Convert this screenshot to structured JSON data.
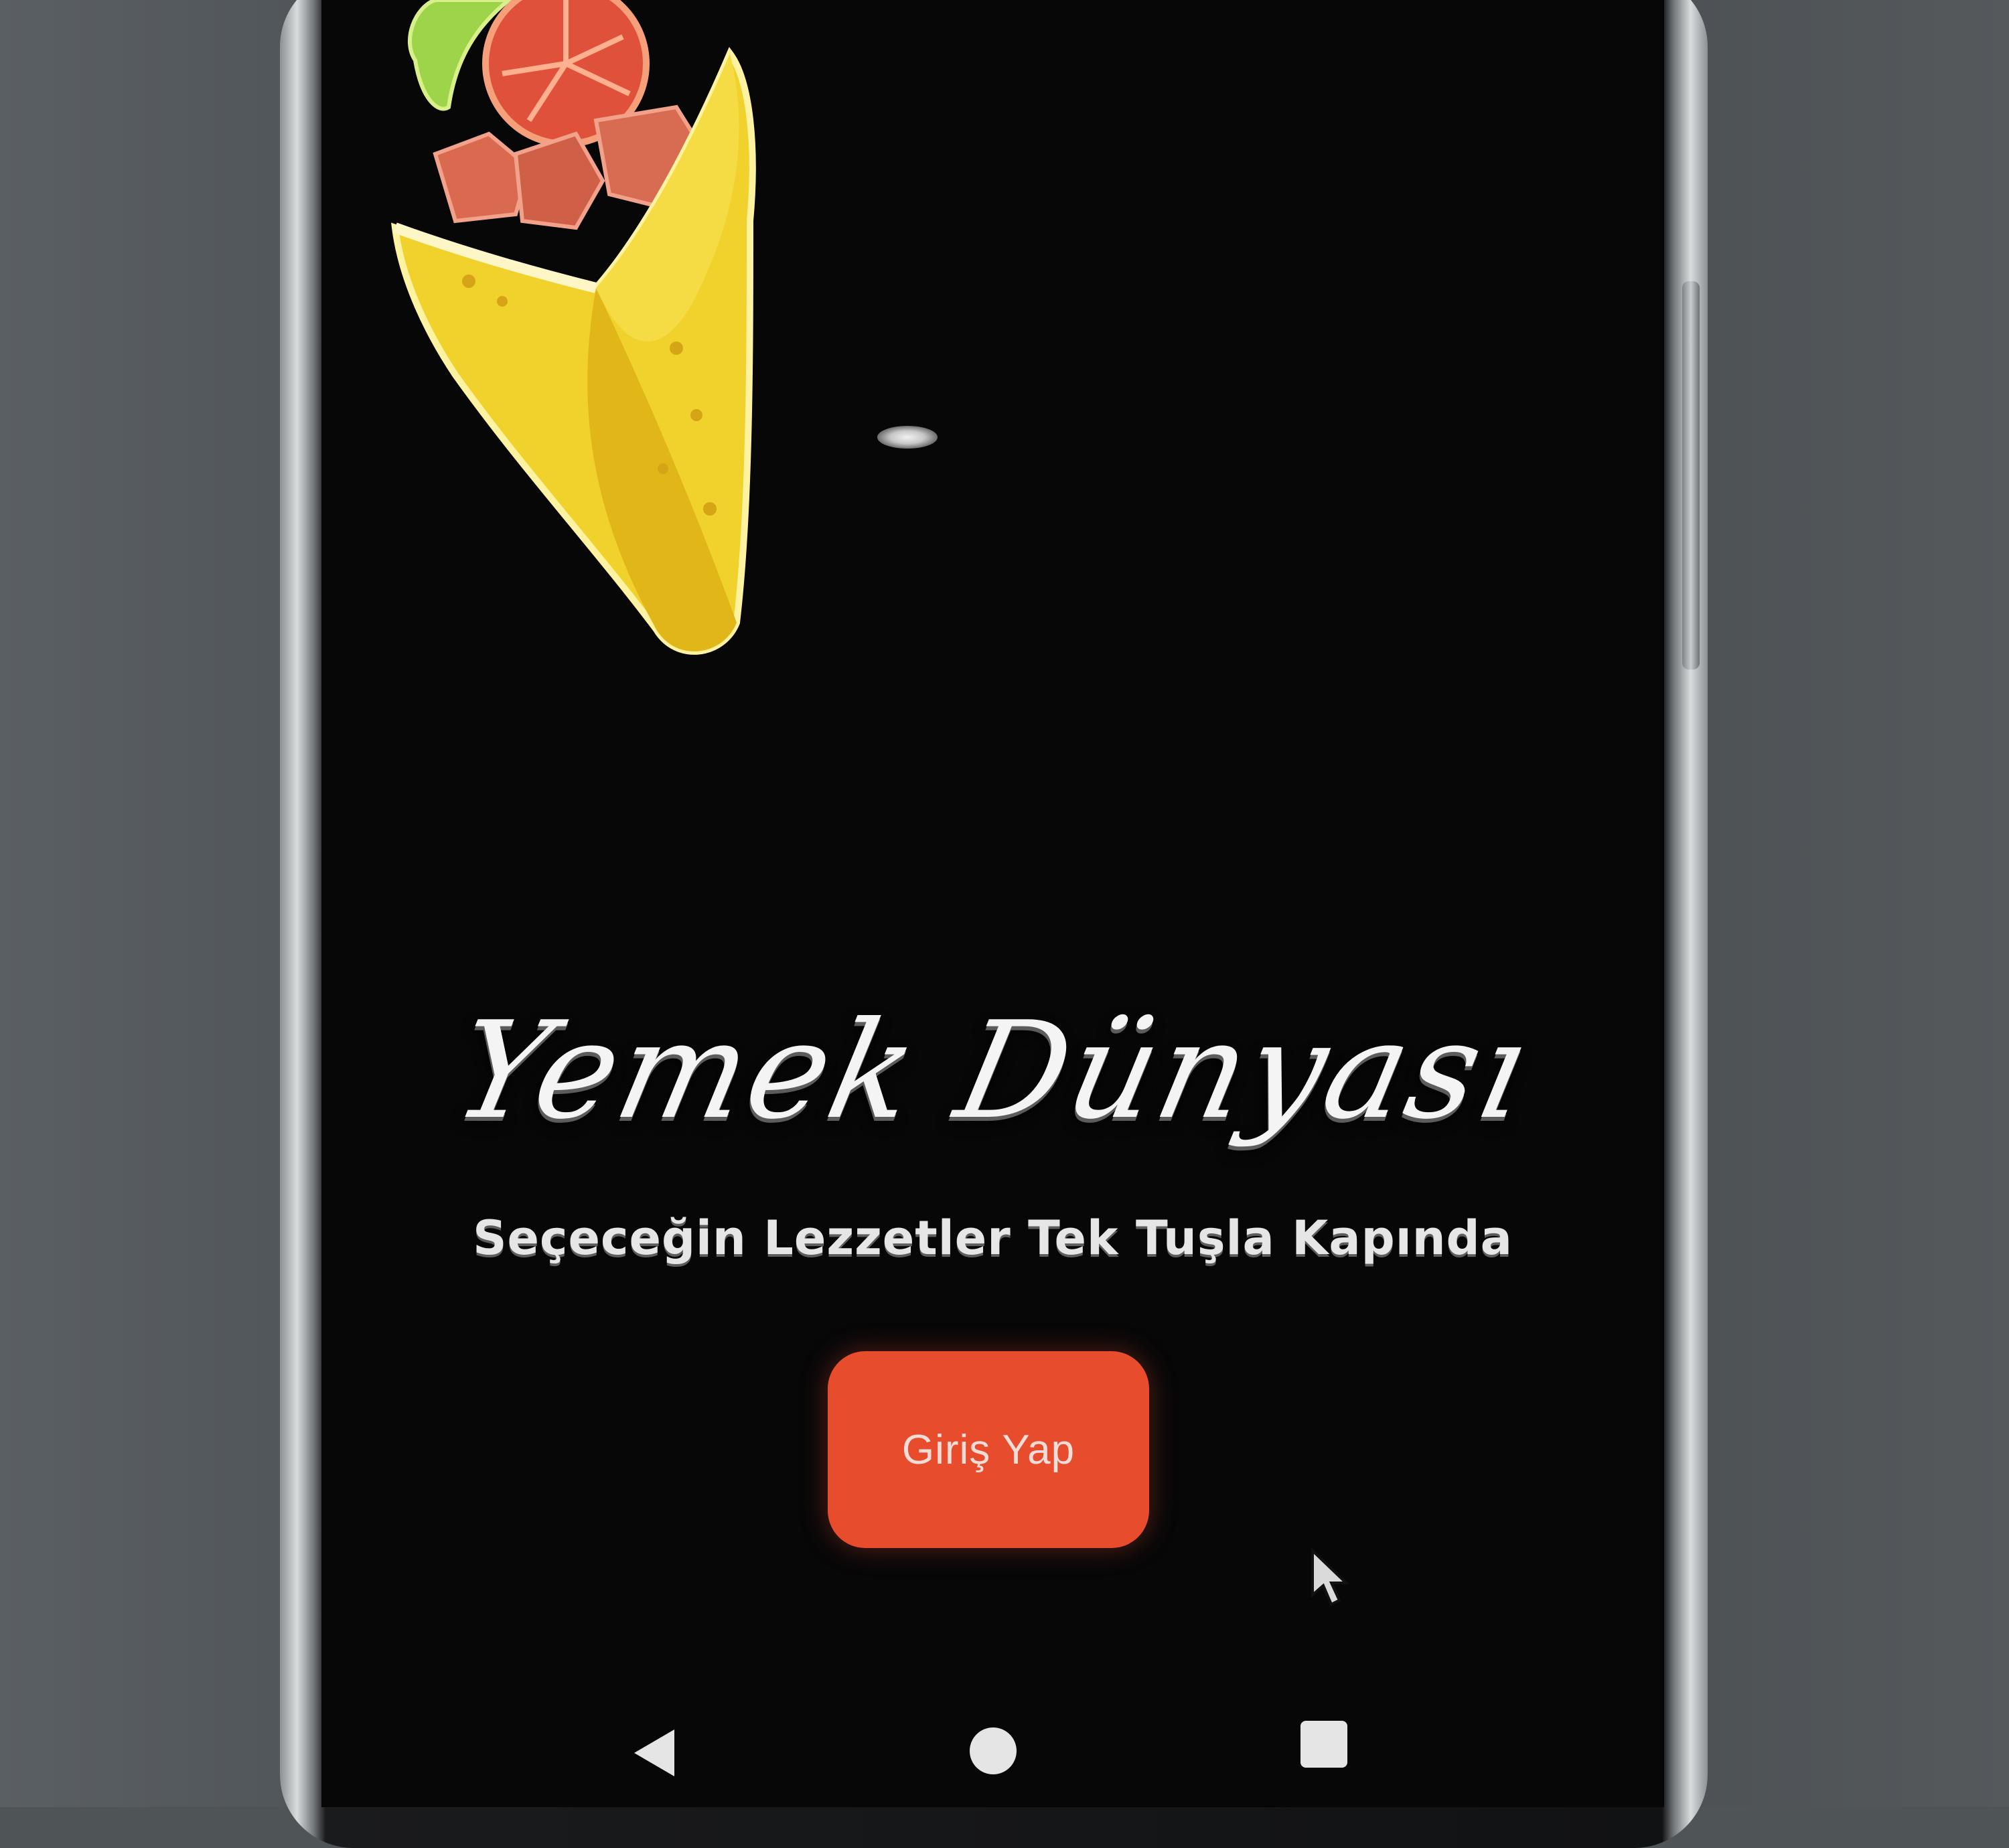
{
  "app": {
    "title": "Yemek Dünyası",
    "tagline": "Seçeceğin Lezzetler Tek Tuşla Kapında"
  },
  "actions": {
    "login_label": "Giriş Yap"
  },
  "colors": {
    "screen_background": "#070708",
    "login_button": "#e74c2d",
    "wrap_yellow": "#f1d12b",
    "tomato_red": "#e0513b",
    "lettuce_green": "#9ed44a"
  },
  "icons": {
    "hero": "wrap-food-icon",
    "nav_back": "back-triangle-icon",
    "nav_home": "home-circle-icon",
    "nav_recents": "recents-square-icon",
    "pointer": "mouse-cursor-icon"
  }
}
